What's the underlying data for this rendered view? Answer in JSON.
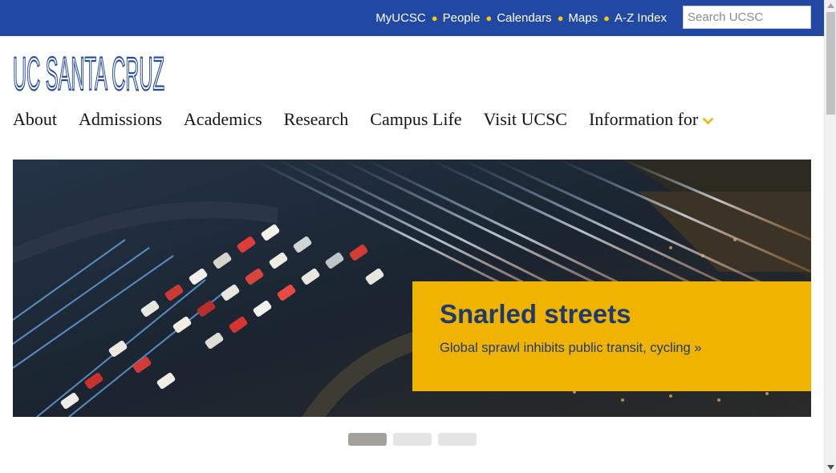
{
  "utility_nav": {
    "links": [
      "MyUCSC",
      "People",
      "Calendars",
      "Maps",
      "A-Z Index"
    ],
    "search_placeholder": "Search UCSC"
  },
  "logo": {
    "text": "UC SANTA CRUZ"
  },
  "main_nav": {
    "items": [
      "About",
      "Admissions",
      "Academics",
      "Research",
      "Campus Life",
      "Visit UCSC",
      "Information for"
    ]
  },
  "hero": {
    "title": "Snarled streets",
    "subtitle": "Global sprawl inhibits public transit, cycling »"
  },
  "carousel": {
    "slide_count": 3,
    "active_index": 0
  },
  "colors": {
    "brand_blue": "#2149a3",
    "accent_gold": "#f0b400",
    "caption_text": "#1e3a6e"
  },
  "icons": {
    "nav_dropdown": "chevron-down-icon",
    "separator": "dot-icon"
  }
}
